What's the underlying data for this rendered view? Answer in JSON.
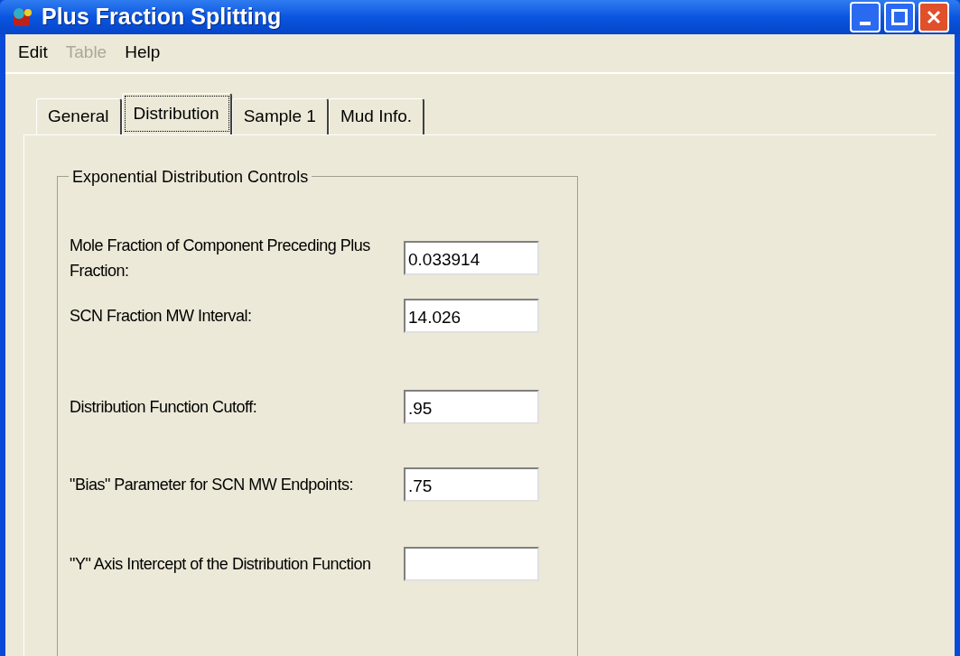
{
  "window": {
    "title": "Plus Fraction Splitting"
  },
  "menu": [
    {
      "label": "Edit",
      "disabled": false
    },
    {
      "label": "Table",
      "disabled": true
    },
    {
      "label": "Help",
      "disabled": false
    }
  ],
  "tabs": [
    {
      "label": "General",
      "selected": false
    },
    {
      "label": "Distribution",
      "selected": true
    },
    {
      "label": "Sample 1",
      "selected": false
    },
    {
      "label": "Mud Info.",
      "selected": false
    }
  ],
  "group": {
    "title": "Exponential Distribution Controls",
    "fields": [
      {
        "label": "Mole Fraction of Component Preceding Plus Fraction:",
        "value": "0.033914"
      },
      {
        "label": "SCN Fraction MW Interval:",
        "value": "14.026"
      },
      {
        "label": "Distribution Function Cutoff:",
        "value": ".95"
      },
      {
        "label": "\"Bias\" Parameter for SCN MW Endpoints:",
        "value": ".75"
      },
      {
        "label": "\"Y\" Axis Intercept of the Distribution Function"
      }
    ]
  }
}
